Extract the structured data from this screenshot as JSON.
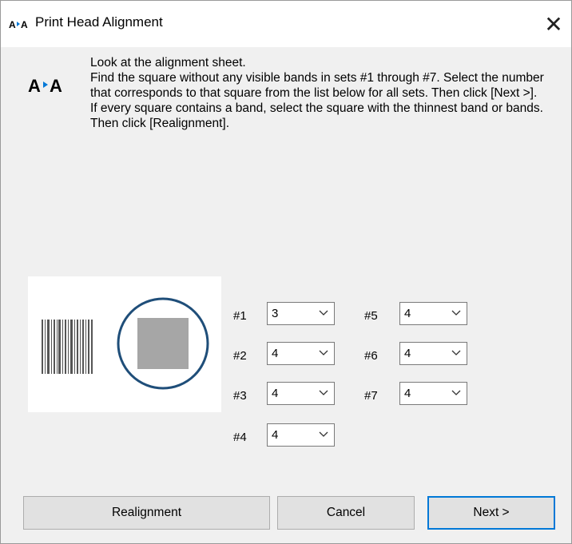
{
  "window": {
    "title": "Print Head Alignment",
    "icon": "print-head-alignment-icon"
  },
  "instructions": [
    "Look at the alignment sheet.",
    "Find the square without any visible bands in sets #1 through #7. Select the number that corresponds to that square from the list below for all sets. Then click [Next >].",
    "If every square contains a band, select the square with the thinnest band or bands. Then click [Realignment]."
  ],
  "sets": [
    {
      "label": "#1",
      "value": "3"
    },
    {
      "label": "#2",
      "value": "4"
    },
    {
      "label": "#3",
      "value": "4"
    },
    {
      "label": "#4",
      "value": "4"
    },
    {
      "label": "#5",
      "value": "4"
    },
    {
      "label": "#6",
      "value": "4"
    },
    {
      "label": "#7",
      "value": "4"
    }
  ],
  "buttons": {
    "realignment": "Realignment",
    "cancel": "Cancel",
    "next": "Next >"
  },
  "colors": {
    "accent": "#0078d7",
    "circle": "#1f4e79",
    "square": "#a6a6a6"
  }
}
